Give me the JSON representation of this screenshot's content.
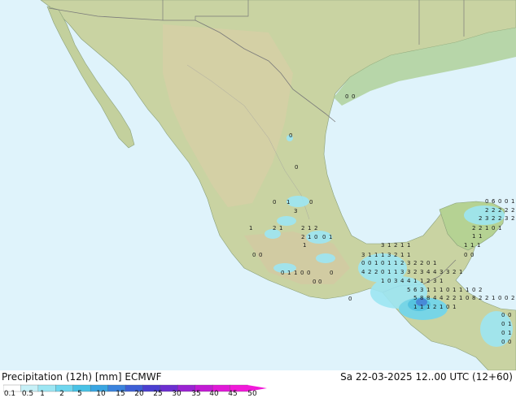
{
  "map": {
    "colors": {
      "ocean": "#dff3fb",
      "land_low": "#b9d59a",
      "land_mid": "#d8d39e",
      "land_high": "#cfc5a0",
      "border": "#7a7a7a"
    },
    "precip_labels": [
      "0",
      "0",
      "0",
      "0",
      "0",
      "1",
      "0",
      "3",
      "1",
      "2",
      "1",
      "2",
      "1",
      "2",
      "2",
      "1",
      "0",
      "0",
      "1",
      "1",
      "0",
      "0",
      "0",
      "1",
      "1",
      "0",
      "0",
      "0",
      "0",
      "0",
      "3",
      "1",
      "2",
      "1",
      "1",
      "3",
      "1",
      "1",
      "1",
      "3",
      "2",
      "1",
      "1",
      "0",
      "0",
      "1",
      "0",
      "1",
      "1",
      "2",
      "3",
      "2",
      "2",
      "0",
      "1",
      "4",
      "2",
      "2",
      "0",
      "1",
      "1",
      "3",
      "3",
      "2",
      "3",
      "4",
      "4",
      "3",
      "3",
      "2",
      "1",
      "1",
      "0",
      "3",
      "4",
      "4",
      "1",
      "1",
      "2",
      "3",
      "1",
      "5",
      "6",
      "3",
      "1",
      "1",
      "1",
      "0",
      "1",
      "1",
      "1",
      "0",
      "2",
      "5",
      "8",
      "8",
      "4",
      "4",
      "2",
      "2",
      "1",
      "0",
      "8",
      "2",
      "2",
      "1",
      "0",
      "0",
      "2",
      "1",
      "1",
      "1",
      "2",
      "1",
      "0",
      "1",
      "0",
      "0",
      "6",
      "0",
      "0",
      "1",
      "2",
      "2",
      "2",
      "2",
      "2",
      "2",
      "3",
      "2",
      "2",
      "3",
      "2",
      "2",
      "2",
      "1",
      "0",
      "1",
      "1",
      "1",
      "1",
      "1",
      "1",
      "0",
      "0",
      "0",
      "0",
      "0",
      "1",
      "0",
      "1",
      "0",
      "0",
      "1",
      "2",
      "0",
      "3",
      "2",
      "1"
    ]
  },
  "legend": {
    "title": "Precipitation (12h) [mm] ECMWF",
    "datetime": "Sa 22-03-2025 12..00 UTC (12+60)",
    "ticks": [
      "0.1",
      "0.5",
      "1",
      "2",
      "5",
      "10",
      "15",
      "20",
      "25",
      "30",
      "35",
      "40",
      "45",
      "50"
    ],
    "colors": [
      "#ffffff",
      "#c7f0f7",
      "#9de6f3",
      "#6fd6ee",
      "#49c2e6",
      "#3aa6e2",
      "#3b83dd",
      "#3e5fd6",
      "#4b3fd0",
      "#6c2fd0",
      "#9a23d2",
      "#c21bd4",
      "#e019d7",
      "#f11ad9"
    ]
  }
}
